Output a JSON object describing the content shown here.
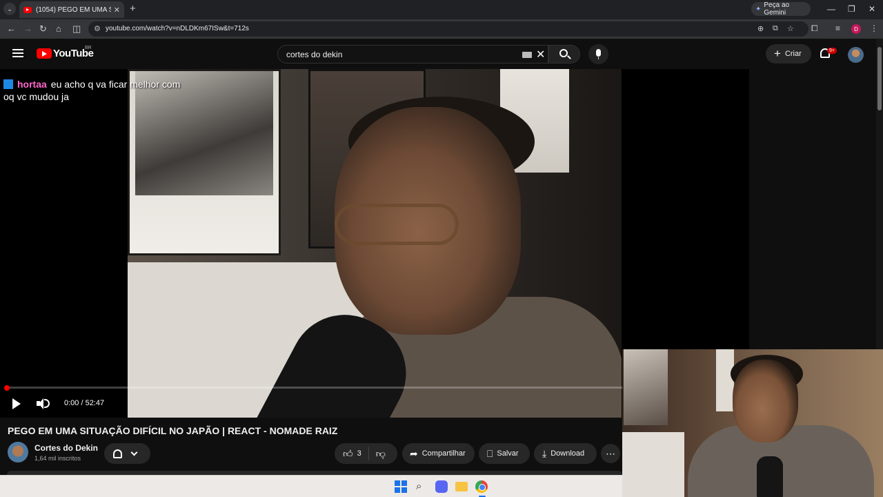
{
  "browser": {
    "tab_title": "(1054) PEGO EM UMA SITUAÇÃ...",
    "gemini_label": "Peça ao Gemini",
    "url": "youtube.com/watch?v=nDLDKm67ISw&t=712s",
    "profile_initial": "D"
  },
  "youtube": {
    "logo_text": "YouTube",
    "country": "BR",
    "search_query": "cortes do dekin",
    "create_label": "Criar",
    "notif_badge": "9+"
  },
  "player": {
    "chat_user": "hortaa",
    "chat_message": "eu acho q va ficar melhor com oq vc mudou ja",
    "time": "0:00 / 52:47",
    "progress": 0.0
  },
  "video": {
    "title": "PEGO EM UMA SITUAÇÃO DIFÍCIL NO JAPÃO | REACT - NOMADE RAIZ",
    "channel_name": "Cortes do Dekin",
    "subscribers": "1,64 mil inscritos",
    "like_count": "3",
    "share_label": "Compartilhar",
    "save_label": "Salvar",
    "download_label": "Download"
  },
  "colors": {
    "youtube_red": "#ff0000",
    "chat_username": "#ff66cc",
    "background": "#0f0f0f"
  }
}
